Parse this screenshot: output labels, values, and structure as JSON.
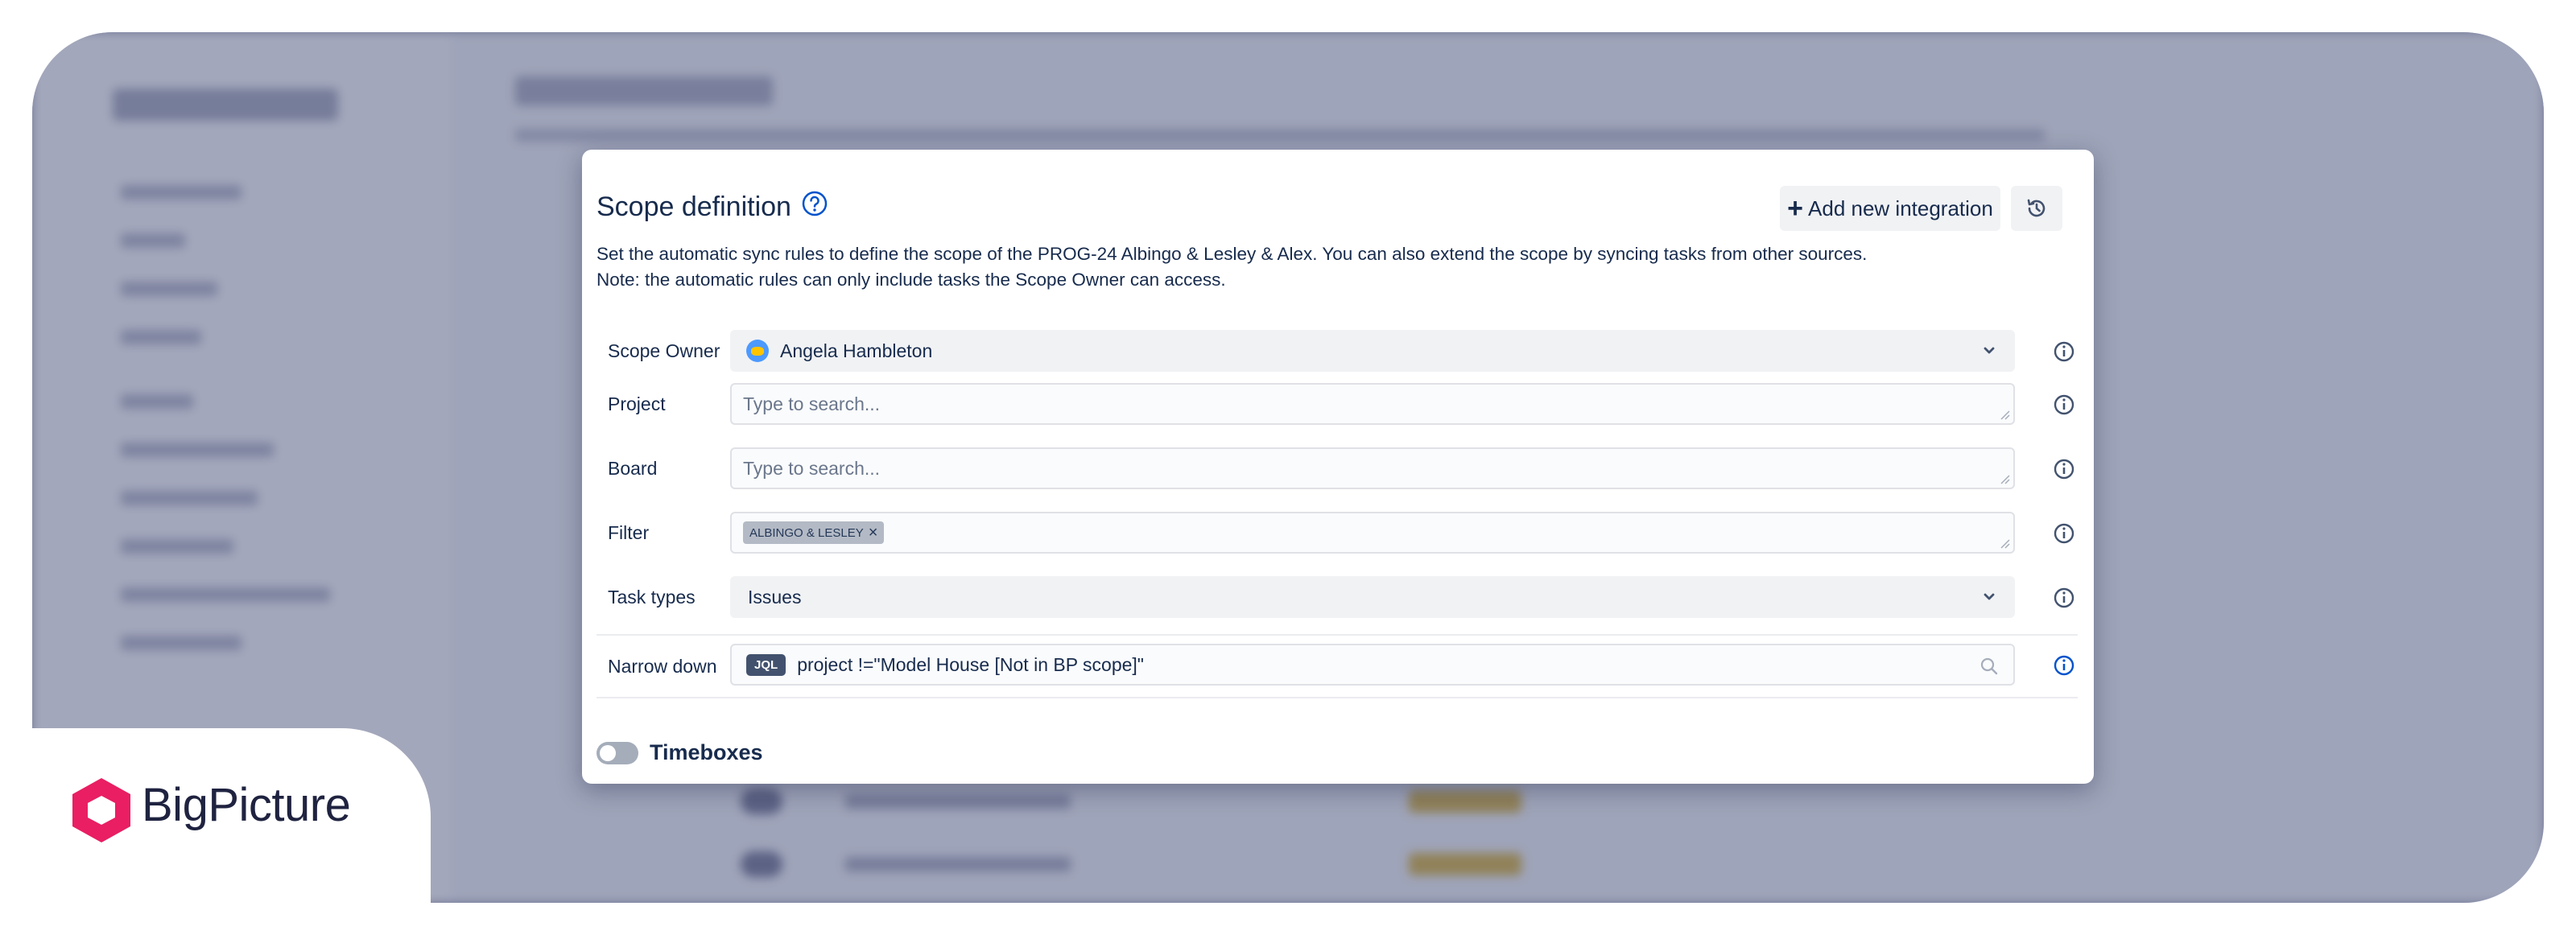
{
  "brand": {
    "name": "BigPicture",
    "color": "#e91e63"
  },
  "modal": {
    "title": "Scope definition",
    "add_integration_label": "Add new integration",
    "description": "Set the automatic sync rules to define the scope of the PROG-24 Albingo & Lesley & Alex. You can also extend the scope by syncing tasks from other sources. Note: the automatic rules can only include tasks the Scope Owner can access.",
    "fields": {
      "scope_owner": {
        "label": "Scope Owner",
        "value": "Angela Hambleton"
      },
      "project": {
        "label": "Project",
        "placeholder": "Type to search..."
      },
      "board": {
        "label": "Board",
        "placeholder": "Type to search..."
      },
      "filter": {
        "label": "Filter",
        "tag": "ALBINGO & LESLEY"
      },
      "task_types": {
        "label": "Task types",
        "value": "Issues"
      },
      "narrow_down": {
        "label": "Narrow down",
        "badge": "JQL",
        "value": "project !=\"Model House [Not in BP scope]\""
      }
    },
    "timeboxes": {
      "label": "Timeboxes",
      "enabled": false
    }
  },
  "icons": [
    "help-circle-icon",
    "plus-icon",
    "history-icon",
    "chevron-down-icon",
    "info-icon",
    "search-icon",
    "close-icon",
    "avatar-icon",
    "logo-hexagon-icon"
  ]
}
